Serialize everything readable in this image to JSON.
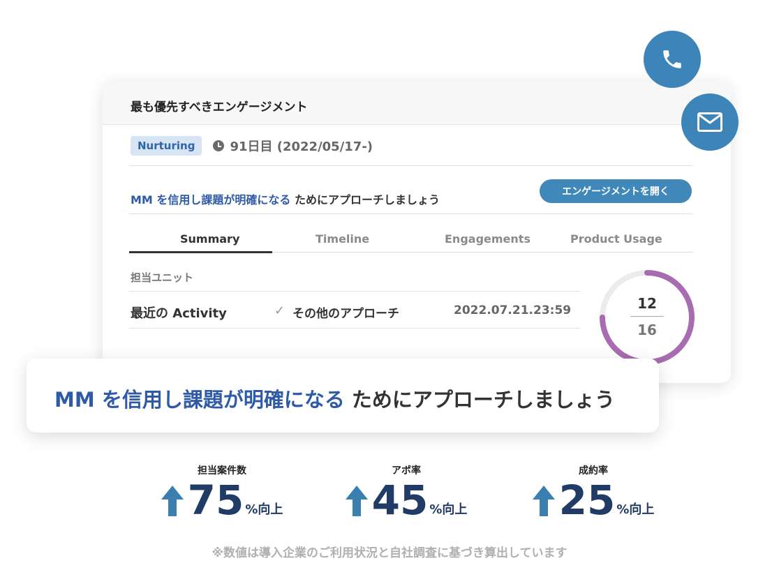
{
  "card": {
    "title": "最も優先すべきエンゲージメント",
    "badge": "Nurturing",
    "day_text": "91日目 (2022/05/17-)",
    "approach_highlight": "MM を信用し課題が明確になる",
    "approach_rest": " ためにアプローチしましょう",
    "open_button": "エンゲージメントを開く",
    "tabs": [
      "Summary",
      "Timeline",
      "Engagements",
      "Product Usage"
    ],
    "active_tab": "Summary",
    "unit_label": "担当ユニット",
    "activity_label": "最近の Activity",
    "activity_type": "その他のアプローチ",
    "activity_date": "2022.07.21.23:59",
    "ring": {
      "numerator": "12",
      "denominator": "16",
      "fraction": 0.75,
      "color": "#a86cb0"
    }
  },
  "banner": {
    "highlight": "MM を信用し課題が明確になる",
    "rest": " ためにアプローチしましょう"
  },
  "stats": [
    {
      "label": "担当案件数",
      "value": "75",
      "suffix": "%向上"
    },
    {
      "label": "アポ率",
      "value": "45",
      "suffix": "%向上"
    },
    {
      "label": "成約率",
      "value": "25",
      "suffix": "%向上"
    }
  ],
  "footnote": "※数値は導入企業のご利用状況と自社調査に基づき算出しています",
  "colors": {
    "accent": "#3d85b8",
    "highlight_text": "#2f5aa8",
    "stat_text": "#1f3b66"
  },
  "icons": {
    "phone": "phone-icon",
    "mail": "mail-icon",
    "clock": "clock-icon",
    "check": "check-icon",
    "arrow": "arrow-up-icon"
  }
}
